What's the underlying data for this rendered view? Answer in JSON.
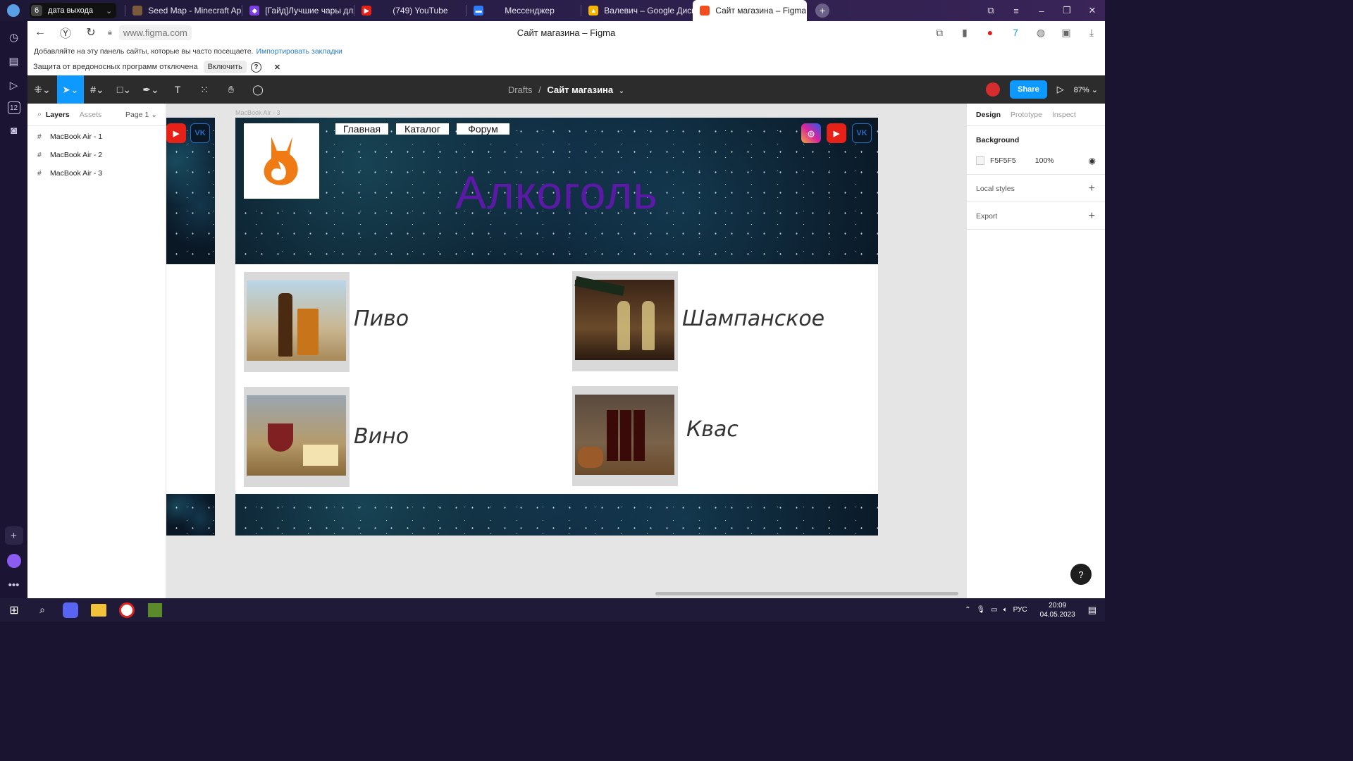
{
  "browser": {
    "tab_group": {
      "count": "6",
      "label": "дата выхода"
    },
    "tabs": [
      {
        "label": "Seed Map - Minecraft App",
        "fav_color": "#7a5a3a"
      },
      {
        "label": "[Гайд]Лучшие чары для в",
        "fav_color": "#7b3fe4"
      },
      {
        "label": "(749) YouTube",
        "fav_color": "#e62117"
      },
      {
        "label": "Мессенджер",
        "fav_color": "#2d7cf6"
      },
      {
        "label": "Валевич – Google Диск",
        "fav_color": "#f4b400"
      },
      {
        "label": "Сайт магазина – Figma",
        "fav_color": "#f24e1e",
        "active": true
      }
    ],
    "url": "www.figma.com",
    "page_title": "Сайт магазина – Figma",
    "bookmarks_text": "Добавляйте на эту панель сайты, которые вы часто посещаете.",
    "bookmarks_link": "Импортировать закладки",
    "protection_text": "Защита от вредоносных программ отключена",
    "protection_button": "Включить",
    "sidebar_badge": "12"
  },
  "figma": {
    "breadcrumb_parent": "Drafts",
    "breadcrumb_sep": "/",
    "file_name": "Сайт магазина",
    "share_label": "Share",
    "zoom": "87%",
    "layers_tab": "Layers",
    "assets_tab": "Assets",
    "page_selector": "Page 1",
    "layers": [
      "MacBook Air - 1",
      "MacBook Air - 2",
      "MacBook Air - 3"
    ],
    "frame_label": "MacBook Air - 3",
    "right_tabs": {
      "design": "Design",
      "prototype": "Prototype",
      "inspect": "Inspect"
    },
    "background_title": "Background",
    "background_hex": "F5F5F5",
    "background_opacity": "100%",
    "local_styles": "Local styles",
    "export": "Export",
    "help": "?"
  },
  "site": {
    "nav": [
      "Главная",
      "Каталог",
      "Форум"
    ],
    "hero_title": "Алкоголь",
    "products": [
      "Пиво",
      "Шампанское",
      "Вино",
      "Квас"
    ],
    "colors": {
      "hero_title": "#5a1aa6",
      "logo_fox": "#f07a14"
    }
  },
  "taskbar": {
    "lang": "РУС",
    "time": "20:09",
    "date": "04.05.2023"
  }
}
